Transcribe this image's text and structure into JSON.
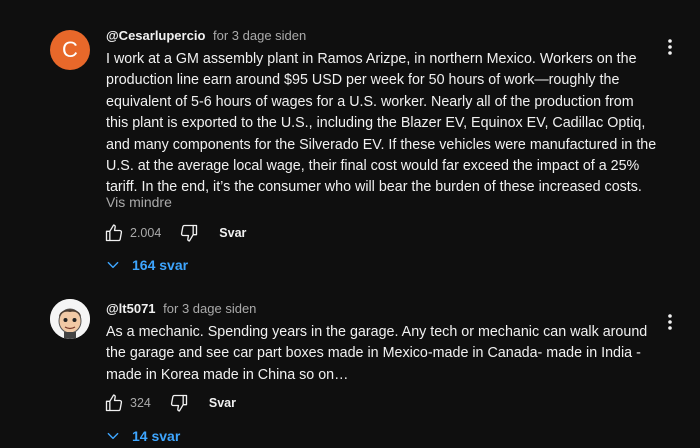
{
  "comments": [
    {
      "author": "@Cesarlupercio",
      "time": "for 3 dage siden",
      "avatar_letter": "C",
      "avatar_color": "#e8682a",
      "text": "I work at a GM assembly plant in Ramos Arizpe, in northern Mexico. Workers on the production line earn around $95 USD per week for 50 hours of work—roughly the equivalent of 5-6 hours of wages for a U.S. worker. Nearly all of the production from this plant is exported to the U.S., including the Blazer EV, Equinox EV, Cadillac Optiq, and many components for the Silverado EV. If these vehicles were manufactured in the U.S. at the average local wage, their final cost would far exceed the impact of a 25% tariff. In the end, it’s the consumer who will bear the burden of these increased costs.",
      "read_more": "Vis mindre",
      "likes": "2.004",
      "reply_label": "Svar",
      "replies": "164 svar"
    },
    {
      "author": "@lt5071",
      "time": "for 3 dage siden",
      "avatar_icon": "cartoon-face-avatar",
      "text": "As a mechanic. Spending years in the garage. Any tech or mechanic can walk around the garage and see car part boxes made in Mexico-made in Canada- made in India - made in Korea made in China so on…",
      "likes": "324",
      "reply_label": "Svar",
      "replies": "14 svar"
    }
  ],
  "colors": {
    "background": "#0f0f0f",
    "text": "#f1f1f1",
    "secondary": "#aaaaaa",
    "link": "#3ea6ff"
  }
}
